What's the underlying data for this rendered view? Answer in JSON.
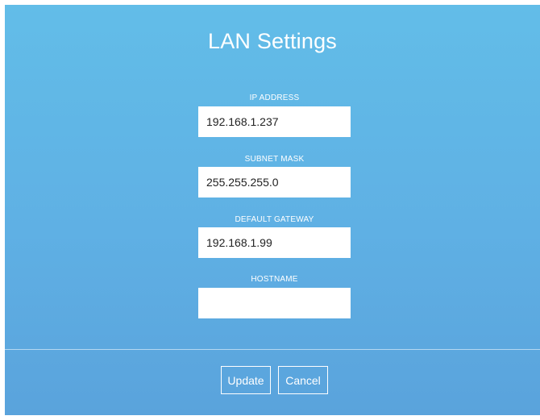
{
  "dialog": {
    "title": "LAN Settings",
    "fields": [
      {
        "label": "IP ADDRESS",
        "value": "192.168.1.237",
        "placeholder": ""
      },
      {
        "label": "SUBNET MASK",
        "value": "255.255.255.0",
        "placeholder": ""
      },
      {
        "label": "DEFAULT GATEWAY",
        "value": "192.168.1.99",
        "placeholder": ""
      },
      {
        "label": "HOSTNAME",
        "value": "",
        "placeholder": ""
      }
    ],
    "buttons": {
      "update_label": "Update",
      "cancel_label": "Cancel"
    }
  },
  "colors": {
    "background_top": "#62bde8",
    "background_bottom": "#5aa3dc",
    "text": "#ffffff",
    "input_background": "#ffffff"
  }
}
